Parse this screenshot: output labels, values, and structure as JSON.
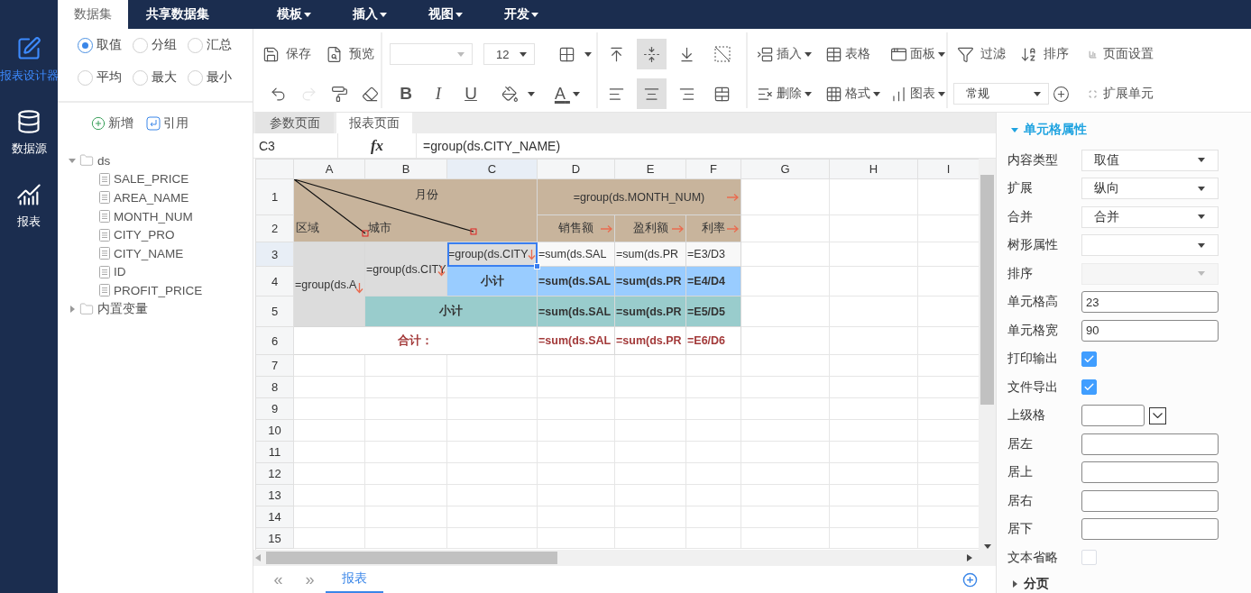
{
  "nav": [
    {
      "label": "报表设计器",
      "selected": true
    },
    {
      "label": "数据源",
      "selected": false
    },
    {
      "label": "报表",
      "selected": false
    }
  ],
  "top_tabs": [
    {
      "label": "数据集",
      "selected": true
    },
    {
      "label": "共享数据集",
      "selected": false
    }
  ],
  "menus": [
    "模板",
    "插入",
    "视图",
    "开发"
  ],
  "aggregate_options": [
    {
      "label": "取值",
      "selected": true
    },
    {
      "label": "分组",
      "selected": false
    },
    {
      "label": "汇总",
      "selected": false
    },
    {
      "label": "平均",
      "selected": false
    },
    {
      "label": "最大",
      "selected": false
    },
    {
      "label": "最小",
      "selected": false
    }
  ],
  "dataset_actions": [
    "新增",
    "引用"
  ],
  "tree": [
    {
      "label": "ds",
      "expanded": true,
      "children": [
        {
          "label": "SALE_PRICE"
        },
        {
          "label": "AREA_NAME"
        },
        {
          "label": "MONTH_NUM"
        },
        {
          "label": "CITY_PRO"
        },
        {
          "label": "CITY_NAME"
        },
        {
          "label": "ID"
        },
        {
          "label": "PROFIT_PRICE"
        }
      ]
    },
    {
      "label": "内置变量",
      "expanded": false
    }
  ],
  "toolbar": {
    "file_buttons": [
      "保存",
      "预览"
    ],
    "edit_buttons": [
      {
        "disabled": false
      },
      {
        "disabled": true
      },
      {
        "disabled": false
      },
      {
        "disabled": false
      }
    ],
    "font_size": "12",
    "text_styles": [
      "B",
      "I",
      "U"
    ],
    "font_color": "A",
    "vertical_align": [
      {
        "selected": false
      },
      {
        "selected": true
      },
      {
        "selected": false
      }
    ],
    "horizontal_align": [
      {
        "selected": false
      },
      {
        "selected": true
      },
      {
        "selected": false
      }
    ],
    "structure_buttons": [
      {
        "label": "插入",
        "dropdown": true
      },
      {
        "label": "表格",
        "dropdown": false
      },
      {
        "label": "面板",
        "dropdown": true
      },
      {
        "label": "删除",
        "dropdown": true
      },
      {
        "label": "格式",
        "dropdown": true
      },
      {
        "label": "图表",
        "dropdown": true
      }
    ],
    "tool_buttons": [
      "过滤",
      "排序",
      "页面设置"
    ],
    "number_format": "常规",
    "expand_button": "扩展单元"
  },
  "sheet_tabs": [
    {
      "label": "参数页面",
      "selected": false
    },
    {
      "label": "报表页面",
      "selected": true
    }
  ],
  "formula_bar": {
    "cell": "C3",
    "fx": "fx",
    "formula": "=group(ds.CITY_NAME)"
  },
  "grid": {
    "columns": [
      {
        "label": "A",
        "selected": false
      },
      {
        "label": "B",
        "selected": false
      },
      {
        "label": "C",
        "selected": true
      },
      {
        "label": "D",
        "selected": false
      },
      {
        "label": "E",
        "selected": false
      },
      {
        "label": "F",
        "selected": false
      },
      {
        "label": "G",
        "selected": false
      },
      {
        "label": "H",
        "selected": false
      },
      {
        "label": "I",
        "selected": false
      }
    ],
    "rows": [
      {
        "label": "1",
        "selected": false
      },
      {
        "label": "2",
        "selected": false
      },
      {
        "label": "3",
        "selected": true
      },
      {
        "label": "4",
        "selected": false
      },
      {
        "label": "5",
        "selected": false
      },
      {
        "label": "6",
        "selected": false
      },
      {
        "label": "7",
        "selected": false
      },
      {
        "label": "8",
        "selected": false
      },
      {
        "label": "9",
        "selected": false
      },
      {
        "label": "10",
        "selected": false
      },
      {
        "label": "11",
        "selected": false
      },
      {
        "label": "12",
        "selected": false
      },
      {
        "label": "13",
        "selected": false
      },
      {
        "label": "14",
        "selected": false
      },
      {
        "label": "15",
        "selected": false
      }
    ],
    "corner_labels": [
      "月份",
      "区域",
      "城市"
    ],
    "cells": [
      {
        "kind": "header",
        "text": "=group(ds.MONTH_NUM)",
        "expands_across": true,
        "selected": false
      },
      {
        "kind": "header",
        "text": "销售额",
        "expands_across": true,
        "selected": false
      },
      {
        "kind": "header",
        "text": "盈利额",
        "expands_across": true,
        "selected": false
      },
      {
        "kind": "header",
        "text": "利率",
        "expands_across": true,
        "selected": false
      },
      {
        "kind": "group",
        "text": "=group(ds.A",
        "expands_down": true,
        "selected": false
      },
      {
        "kind": "group",
        "text": "=group(ds.CITY",
        "expands_down": true,
        "selected": false
      },
      {
        "kind": "group",
        "text": "=group(ds.CITY",
        "expands_down": true,
        "selected": true
      },
      {
        "kind": "plain",
        "text": "=sum(ds.SAL",
        "selected": false
      },
      {
        "kind": "plain",
        "text": "=sum(ds.PR",
        "selected": false
      },
      {
        "kind": "plain",
        "text": "=E3/D3",
        "selected": false
      },
      {
        "kind": "subtotal",
        "text": "小计",
        "selected": false
      },
      {
        "kind": "subtotal",
        "text": "=sum(ds.SAL",
        "selected": false
      },
      {
        "kind": "subtotal",
        "text": "=sum(ds.PR",
        "selected": false
      },
      {
        "kind": "subtotal",
        "text": "=E4/D4",
        "selected": false
      },
      {
        "kind": "area_subtotal",
        "text": "小计",
        "selected": false
      },
      {
        "kind": "area_subtotal",
        "text": "=sum(ds.SAL",
        "selected": false
      },
      {
        "kind": "area_subtotal",
        "text": "=sum(ds.PR",
        "selected": false
      },
      {
        "kind": "area_subtotal",
        "text": "=E5/D5",
        "selected": false
      },
      {
        "kind": "total",
        "text": "合计：",
        "selected": false
      },
      {
        "kind": "total",
        "text": "=sum(ds.SAL",
        "selected": false
      },
      {
        "kind": "total",
        "text": "=sum(ds.PR",
        "selected": false
      },
      {
        "kind": "total",
        "text": "=E6/D6",
        "selected": false
      }
    ]
  },
  "sheet_nav": [
    "«",
    "»"
  ],
  "report_tabs": [
    {
      "label": "报表",
      "selected": true
    }
  ],
  "properties": {
    "title": "单元格属性",
    "expanded": true,
    "fields": [
      {
        "kind": "select",
        "label": "内容类型",
        "value": "取值",
        "disabled": false
      },
      {
        "kind": "select",
        "label": "扩展",
        "value": "纵向",
        "disabled": false
      },
      {
        "kind": "select",
        "label": "合并",
        "value": "合并",
        "disabled": false
      },
      {
        "kind": "select",
        "label": "树形属性",
        "disabled": false
      },
      {
        "kind": "select",
        "label": "排序",
        "disabled": true
      },
      {
        "kind": "input",
        "label": "单元格高",
        "value": "23"
      },
      {
        "kind": "input",
        "label": "单元格宽",
        "value": "90"
      },
      {
        "kind": "checkbox",
        "label": "打印输出",
        "checked": true
      },
      {
        "kind": "checkbox",
        "label": "文件导出",
        "checked": true
      },
      {
        "kind": "picker",
        "label": "上级格"
      },
      {
        "kind": "input",
        "label": "居左"
      },
      {
        "kind": "input",
        "label": "居上"
      },
      {
        "kind": "input",
        "label": "居右"
      },
      {
        "kind": "input",
        "label": "居下"
      },
      {
        "kind": "checkbox",
        "label": "文本省略",
        "checked": false
      }
    ],
    "next_section": {
      "title": "分页",
      "expanded": false
    }
  }
}
